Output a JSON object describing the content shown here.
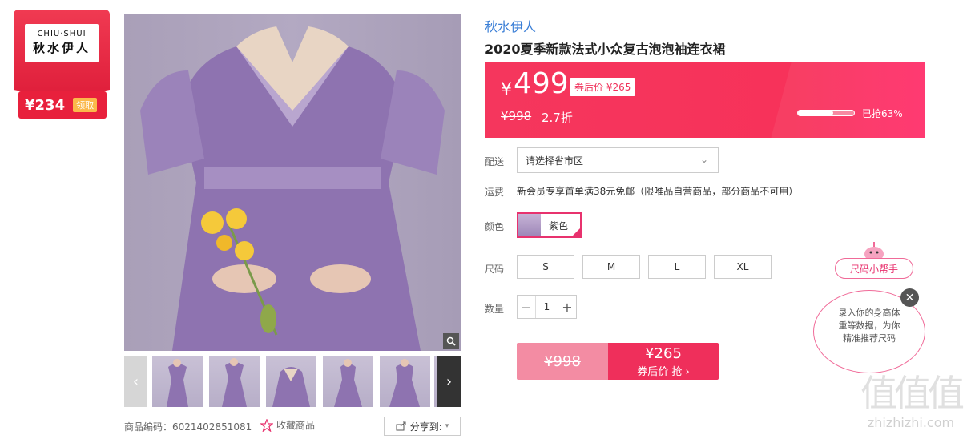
{
  "badge": {
    "logo_en": "CHIU·SHUI",
    "logo_cn": "秋水伊人",
    "coupon_amount": "¥234",
    "coupon_get": "领取"
  },
  "gallery": {
    "thumbnail_count": 5,
    "prev_arrow": "‹",
    "next_arrow": "›"
  },
  "meta": {
    "sku": "商品编码：6021402851081",
    "favorite": "收藏商品",
    "share": "分享到:"
  },
  "product": {
    "brand": "秋水伊人",
    "title": "2020夏季新款法式小众复古泡泡袖连衣裙"
  },
  "pricing": {
    "currency": "¥",
    "price": "499",
    "coupon_tag": "券后价 ¥265",
    "original": "¥998",
    "discount": "2.7折",
    "sold_label": "已抢63%",
    "sold_fraction": 0.63,
    "accent": "#f5365d"
  },
  "options": {
    "ship_label": "配送",
    "ship_placeholder": "请选择省市区",
    "fee_label": "运费",
    "fee_text": "新会员专享首单满38元免邮（限唯品自营商品，部分商品不可用）",
    "color_label": "颜色",
    "color_value": "紫色",
    "size_label": "尺码",
    "sizes": [
      "S",
      "M",
      "L",
      "XL"
    ],
    "qty_label": "数量",
    "qty_value": "1"
  },
  "buy": {
    "original": "¥998",
    "coupon_price": "¥265",
    "action": "券后价 抢 ›"
  },
  "helper": {
    "tag": "尺码小帮手",
    "line1": "录入你的身高体",
    "line2": "重等数据，为你",
    "line3": "精准推荐尺码",
    "close": "✕"
  },
  "watermark": {
    "mark": "值值值",
    "url": "zhizhizhi.com"
  }
}
